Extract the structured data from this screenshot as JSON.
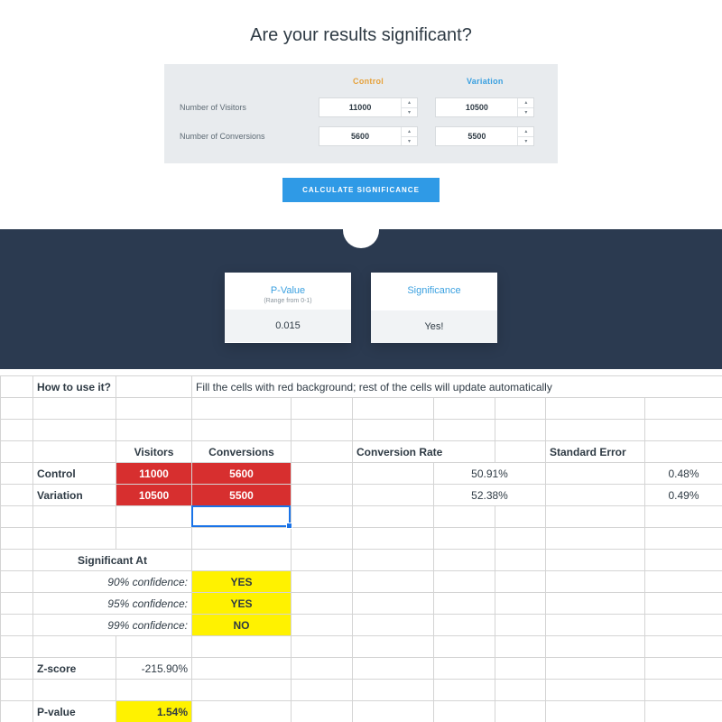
{
  "title": "Are your results significant?",
  "calc": {
    "headers": {
      "control": "Control",
      "variation": "Variation"
    },
    "rows": {
      "visitors_label": "Number of Visitors",
      "conversions_label": "Number of Conversions"
    },
    "control": {
      "visitors": "11000",
      "conversions": "5600"
    },
    "variation": {
      "visitors": "10500",
      "conversions": "5500"
    },
    "button": "CALCULATE SIGNIFICANCE"
  },
  "results": {
    "pvalue": {
      "title": "P-Value",
      "subtitle": "(Range from 0-1)",
      "value": "0.015"
    },
    "significance": {
      "title": "Significance",
      "value": "Yes!"
    }
  },
  "sheet": {
    "howto_label": "How to use it?",
    "howto_text": "Fill the cells with red background; rest of the cells will update automatically",
    "headers": {
      "visitors": "Visitors",
      "conversions": "Conversions",
      "conv_rate": "Conversion Rate",
      "std_err": "Standard Error"
    },
    "rows": {
      "control": {
        "label": "Control",
        "visitors": "11000",
        "conversions": "5600",
        "conv_rate": "50.91%",
        "std_err": "0.48%"
      },
      "variation": {
        "label": "Variation",
        "visitors": "10500",
        "conversions": "5500",
        "conv_rate": "52.38%",
        "std_err": "0.49%"
      }
    },
    "sig_header": "Significant At",
    "sig": {
      "c90_label": "90% confidence:",
      "c90_val": "YES",
      "c95_label": "95% confidence:",
      "c95_val": "YES",
      "c99_label": "99% confidence:",
      "c99_val": "NO"
    },
    "zscore_label": "Z-score",
    "zscore_val": "-215.90%",
    "pvalue_label": "P-value",
    "pvalue_val": "1.54%"
  }
}
